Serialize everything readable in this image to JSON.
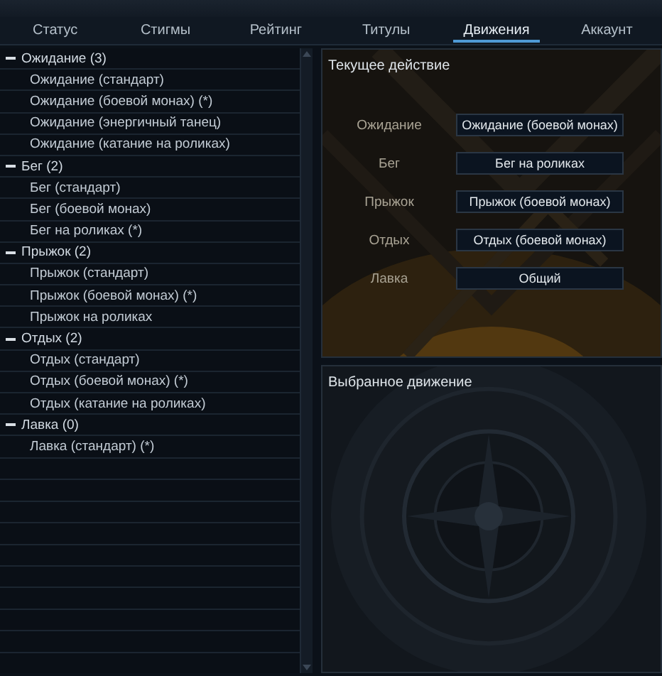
{
  "tabs": [
    {
      "label": "Статус",
      "selected": false
    },
    {
      "label": "Стигмы",
      "selected": false
    },
    {
      "label": "Рейтинг",
      "selected": false
    },
    {
      "label": "Титулы",
      "selected": false
    },
    {
      "label": "Движения",
      "selected": true
    },
    {
      "label": "Аккаунт",
      "selected": false
    }
  ],
  "motion_tree": [
    {
      "label": "Ожидание (3)",
      "expanded": true,
      "children": [
        {
          "label": "Ожидание (стандарт)"
        },
        {
          "label": "Ожидание (боевой монах) (*)"
        },
        {
          "label": "Ожидание (энергичный танец)"
        },
        {
          "label": "Ожидание (катание на роликах)"
        }
      ]
    },
    {
      "label": "Бег (2)",
      "expanded": true,
      "children": [
        {
          "label": "Бег (стандарт)"
        },
        {
          "label": "Бег (боевой монах)"
        },
        {
          "label": "Бег на роликах (*)"
        }
      ]
    },
    {
      "label": "Прыжок (2)",
      "expanded": true,
      "children": [
        {
          "label": "Прыжок (стандарт)"
        },
        {
          "label": "Прыжок (боевой монах) (*)"
        },
        {
          "label": "Прыжок на роликах"
        }
      ]
    },
    {
      "label": "Отдых (2)",
      "expanded": true,
      "children": [
        {
          "label": "Отдых (стандарт)"
        },
        {
          "label": "Отдых (боевой монах) (*)"
        },
        {
          "label": "Отдых (катание на роликах)"
        }
      ]
    },
    {
      "label": "Лавка (0)",
      "expanded": true,
      "children": [
        {
          "label": "Лавка (стандарт) (*)"
        }
      ]
    }
  ],
  "current_action": {
    "title": "Текущее действие",
    "rows": [
      {
        "label": "Ожидание",
        "value": "Ожидание (боевой монах)"
      },
      {
        "label": "Бег",
        "value": "Бег на роликах"
      },
      {
        "label": "Прыжок",
        "value": "Прыжок (боевой монах)"
      },
      {
        "label": "Отдых",
        "value": "Отдых (боевой монах)"
      },
      {
        "label": "Лавка",
        "value": "Общий"
      }
    ]
  },
  "selected_motion": {
    "title": "Выбранное движение"
  }
}
